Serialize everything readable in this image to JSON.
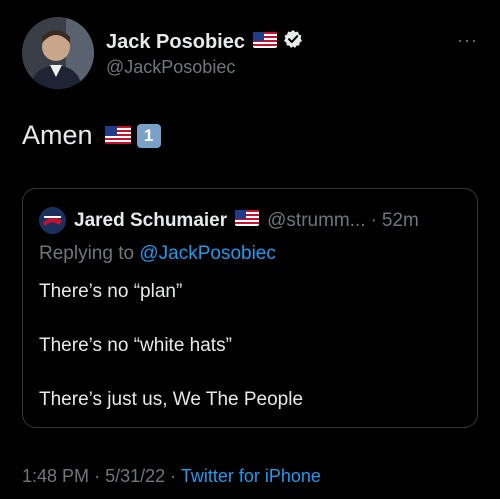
{
  "author": {
    "name": "Jack Posobiec",
    "handle": "@JackPosobiec",
    "flag_icon": "us-flag-icon",
    "verified_icon": "verified-badge-icon"
  },
  "more_label": "···",
  "tweet": {
    "text": "Amen",
    "badge": "1"
  },
  "quoted_tweet": {
    "name": "Jared Schumaier",
    "handle": "@strumm...",
    "separator": "·",
    "time": "52m",
    "replying_prefix": "Replying to",
    "replying_to": "@JackPosobiec",
    "lines": [
      "There’s no “plan”",
      "There’s no “white hats”",
      "There’s just us, We The People"
    ]
  },
  "meta": {
    "time": "1:48 PM",
    "sep1": "·",
    "date": "5/31/22",
    "sep2": "·",
    "source": "Twitter for iPhone"
  },
  "colors": {
    "background": "#000000",
    "text": "#e7e9ea",
    "muted": "#71767b",
    "link": "#1d9bf0",
    "border": "#333639"
  }
}
